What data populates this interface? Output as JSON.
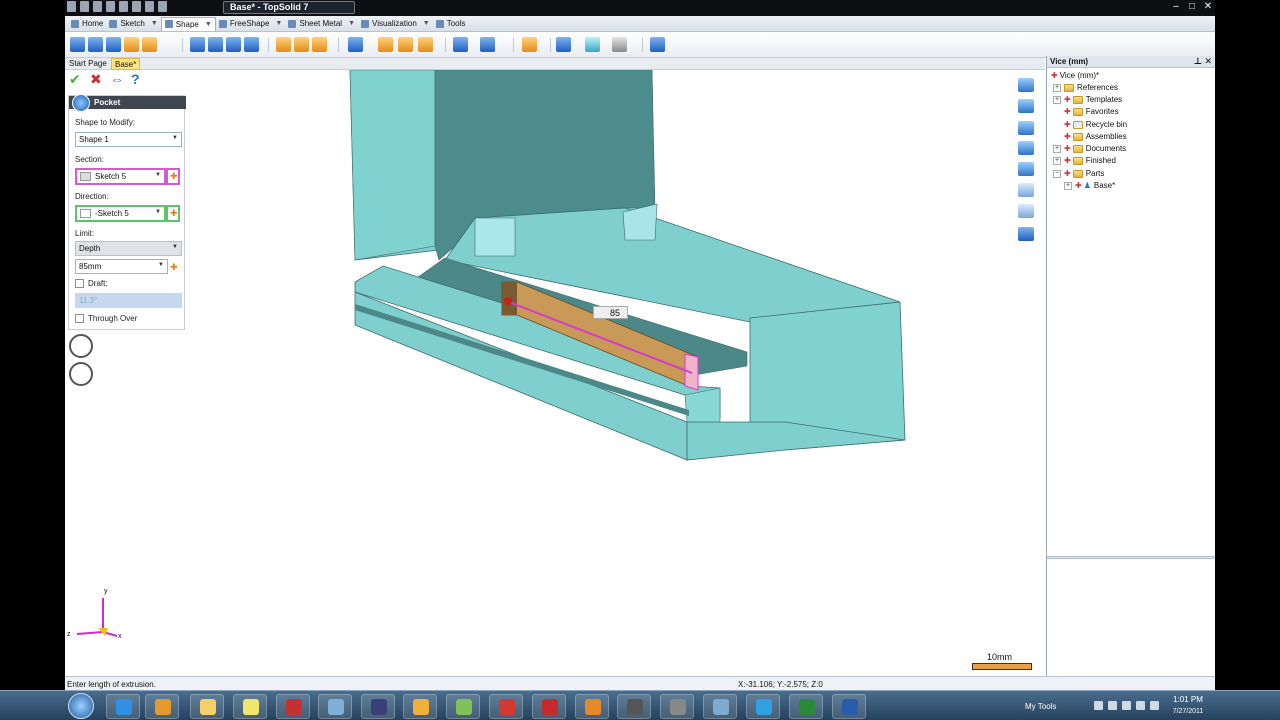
{
  "window": {
    "title": "Base* - TopSolid 7"
  },
  "menu_tabs": [
    {
      "label": "Home"
    },
    {
      "label": "Sketch"
    },
    {
      "label": "Shape"
    },
    {
      "label": "FreeShape"
    },
    {
      "label": "Sheet Metal"
    },
    {
      "label": "Visualization"
    },
    {
      "label": "Tools"
    }
  ],
  "doc_tabs": {
    "start": "Start Page",
    "base": "Base*"
  },
  "pocket": {
    "title": "Pocket",
    "shape_label": "Shape to Modify:",
    "shape_value": "Shape 1",
    "section_label": "Section:",
    "section_value": "Sketch 5",
    "direction_label": "Direction:",
    "direction_value": "-Sketch 5",
    "limit_label": "Limit:",
    "limit_value": "Depth",
    "depth_value": "85mm",
    "draft_label": "Draft:",
    "draft_value": "11.3°",
    "through_label": "Through Over"
  },
  "dimension_label": "85",
  "scale_label": "10mm",
  "axes": {
    "x": "x",
    "y": "y",
    "z": "z"
  },
  "tree": {
    "header": "Vice (mm)",
    "items": [
      {
        "label": "Vice (mm)*"
      },
      {
        "label": "References"
      },
      {
        "label": "Templates"
      },
      {
        "label": "Favorites"
      },
      {
        "label": "Recycle bin"
      },
      {
        "label": "Assemblies"
      },
      {
        "label": "Documents"
      },
      {
        "label": "Finished"
      },
      {
        "label": "Parts"
      },
      {
        "label": "Base*"
      }
    ]
  },
  "status": {
    "message": "Enter length of extrusion.",
    "coords": "X:-31.106; Y:-2.575; Z:0"
  },
  "taskbar": {
    "my_tools": "My Tools",
    "time": "1:01 PM",
    "date": "7/27/2011"
  },
  "colors": {
    "model_face": "#7ecfcd",
    "model_dark": "#4f8f8f",
    "pocket_fill": "#c99a57",
    "sketch_line": "#d43ad0"
  }
}
